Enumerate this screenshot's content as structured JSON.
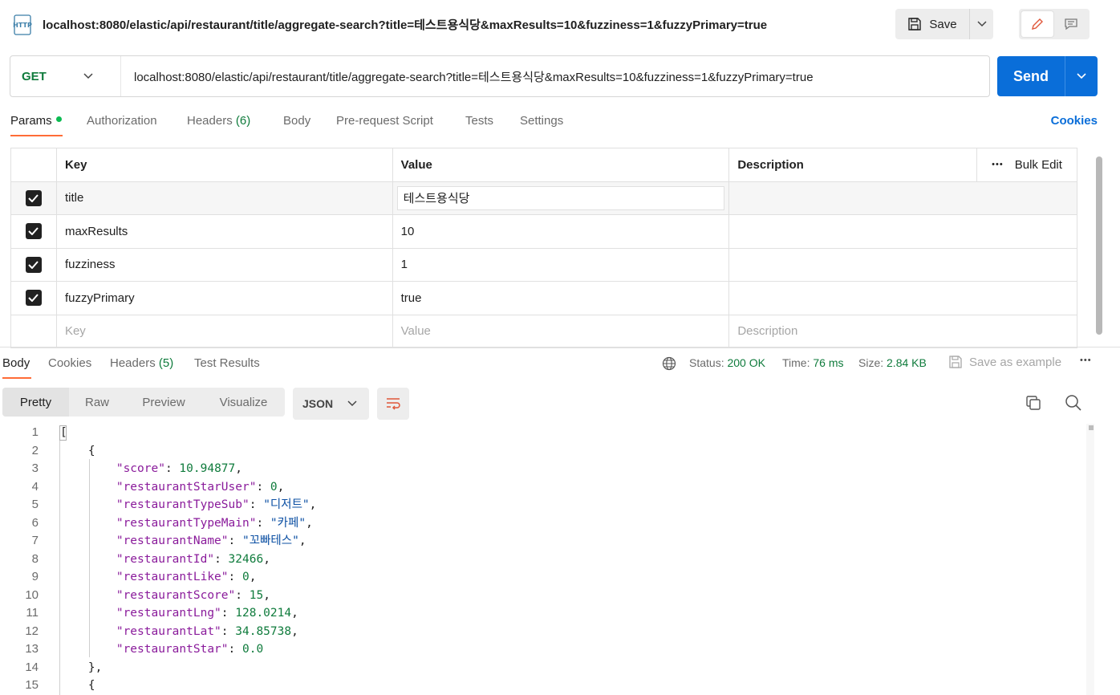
{
  "request": {
    "title": "localhost:8080/elastic/api/restaurant/title/aggregate-search?title=테스트용식당&maxResults=10&fuzziness=1&fuzzyPrimary=true",
    "icon": "http-icon",
    "save_label": "Save",
    "method": "GET",
    "url": "localhost:8080/elastic/api/restaurant/title/aggregate-search?title=테스트용식당&maxResults=10&fuzziness=1&fuzzyPrimary=true",
    "send_label": "Send"
  },
  "request_tabs": {
    "params": "Params",
    "authorization": "Authorization",
    "headers": "Headers",
    "headers_count": "(6)",
    "body": "Body",
    "pre_request": "Pre-request Script",
    "tests": "Tests",
    "settings": "Settings",
    "cookies": "Cookies"
  },
  "params_table": {
    "headers": {
      "key": "Key",
      "value": "Value",
      "description": "Description",
      "bulk_edit": "Bulk Edit",
      "more": "•••"
    },
    "rows": [
      {
        "key": "title",
        "value": "테스트용식당",
        "checked": true
      },
      {
        "key": "maxResults",
        "value": "10",
        "checked": true
      },
      {
        "key": "fuzziness",
        "value": "1",
        "checked": true
      },
      {
        "key": "fuzzyPrimary",
        "value": "true",
        "checked": true
      }
    ],
    "placeholder": {
      "key": "Key",
      "value": "Value",
      "description": "Description"
    }
  },
  "response_tabs": {
    "body": "Body",
    "cookies": "Cookies",
    "headers": "Headers",
    "headers_count": "(5)",
    "test_results": "Test Results"
  },
  "response_meta": {
    "status_label": "Status:",
    "status_value": "200 OK",
    "time_label": "Time:",
    "time_value": "76 ms",
    "size_label": "Size:",
    "size_value": "2.84 KB",
    "save_example": "Save as example",
    "more": "•••"
  },
  "view_modes": {
    "pretty": "Pretty",
    "raw": "Raw",
    "preview": "Preview",
    "visualize": "Visualize",
    "format": "JSON"
  },
  "code_lines": [
    {
      "n": "1",
      "html": "["
    },
    {
      "n": "2",
      "html": "    {"
    },
    {
      "n": "3",
      "html": "        <span class=\"k\">\"score\"</span>: <span class=\"n\">10.94877</span>,"
    },
    {
      "n": "4",
      "html": "        <span class=\"k\">\"restaurantStarUser\"</span>: <span class=\"n\">0</span>,"
    },
    {
      "n": "5",
      "html": "        <span class=\"k\">\"restaurantTypeSub\"</span>: <span class=\"s\">\"디저트\"</span>,"
    },
    {
      "n": "6",
      "html": "        <span class=\"k\">\"restaurantTypeMain\"</span>: <span class=\"s\">\"카페\"</span>,"
    },
    {
      "n": "7",
      "html": "        <span class=\"k\">\"restaurantName\"</span>: <span class=\"s\">\"꼬빠테스\"</span>,"
    },
    {
      "n": "8",
      "html": "        <span class=\"k\">\"restaurantId\"</span>: <span class=\"n\">32466</span>,"
    },
    {
      "n": "9",
      "html": "        <span class=\"k\">\"restaurantLike\"</span>: <span class=\"n\">0</span>,"
    },
    {
      "n": "10",
      "html": "        <span class=\"k\">\"restaurantScore\"</span>: <span class=\"n\">15</span>,"
    },
    {
      "n": "11",
      "html": "        <span class=\"k\">\"restaurantLng\"</span>: <span class=\"n\">128.0214</span>,"
    },
    {
      "n": "12",
      "html": "        <span class=\"k\">\"restaurantLat\"</span>: <span class=\"n\">34.85738</span>,"
    },
    {
      "n": "13",
      "html": "        <span class=\"k\">\"restaurantStar\"</span>: <span class=\"n\">0.0</span>"
    },
    {
      "n": "14",
      "html": "    },"
    },
    {
      "n": "15",
      "html": "    {"
    }
  ],
  "colors": {
    "accent": "#ff6c37",
    "send": "#0a6ed9",
    "method": "#0f7b3c",
    "json_key": "#8a1b9b",
    "json_string": "#0b4fa3",
    "json_number": "#0f7b3c"
  }
}
